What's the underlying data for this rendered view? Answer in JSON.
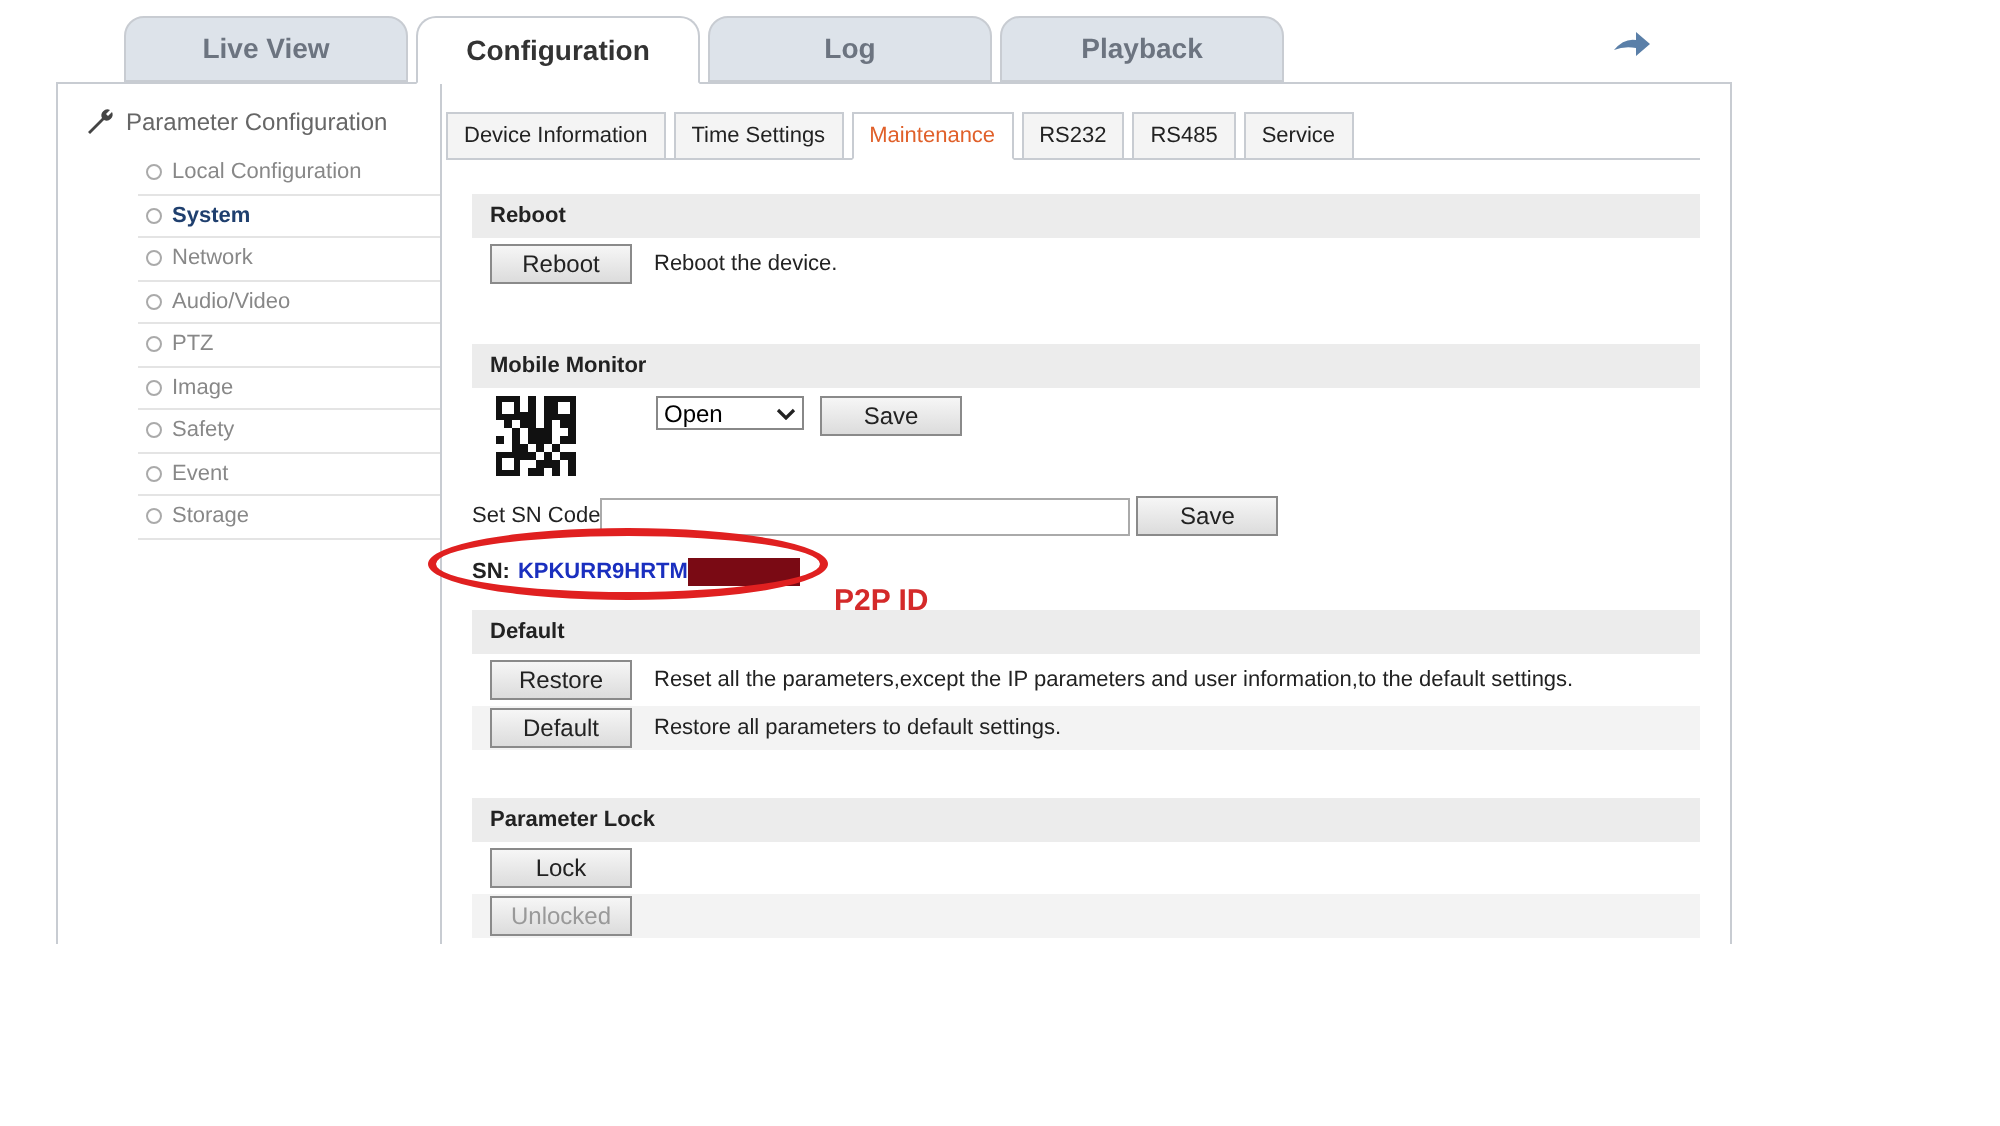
{
  "top_tabs": [
    {
      "label": "Live View",
      "selected": false
    },
    {
      "label": "Configuration",
      "selected": true
    },
    {
      "label": "Log",
      "selected": false
    },
    {
      "label": "Playback",
      "selected": false
    }
  ],
  "sidebar": {
    "title": "Parameter Configuration",
    "items": [
      {
        "label": "Local Configuration",
        "selected": false
      },
      {
        "label": "System",
        "selected": true
      },
      {
        "label": "Network",
        "selected": false
      },
      {
        "label": "Audio/Video",
        "selected": false
      },
      {
        "label": "PTZ",
        "selected": false
      },
      {
        "label": "Image",
        "selected": false
      },
      {
        "label": "Safety",
        "selected": false
      },
      {
        "label": "Event",
        "selected": false
      },
      {
        "label": "Storage",
        "selected": false
      }
    ]
  },
  "sub_tabs": [
    {
      "label": "Device Information",
      "selected": false
    },
    {
      "label": "Time Settings",
      "selected": false
    },
    {
      "label": "Maintenance",
      "selected": true
    },
    {
      "label": "RS232",
      "selected": false
    },
    {
      "label": "RS485",
      "selected": false
    },
    {
      "label": "Service",
      "selected": false
    }
  ],
  "sections": [
    {
      "kind": "actions",
      "title": "Reboot",
      "rows": [
        {
          "button": "Reboot",
          "text": "Reboot the device.",
          "disabled": false
        }
      ]
    },
    {
      "kind": "mobile",
      "title": "Mobile Monitor",
      "select_value": "Open",
      "save": "Save",
      "sn_label": "Set SN Code",
      "sn_save": "Save",
      "sn_prefix": "SN:",
      "sn_value": "KPKURR9HRTM"
    },
    {
      "kind": "actions",
      "title": "Default",
      "rows": [
        {
          "button": "Restore",
          "text": "Reset all the parameters,except the IP parameters and user information,to the default settings.",
          "disabled": false
        },
        {
          "button": "Default",
          "text": "Restore all parameters to default settings.",
          "disabled": false
        }
      ]
    },
    {
      "kind": "actions",
      "title": "Parameter Lock",
      "rows": [
        {
          "button": "Lock",
          "disabled": false
        },
        {
          "button": "Unlocked",
          "disabled": true
        }
      ]
    }
  ],
  "annotation": {
    "label": "P2P ID"
  }
}
